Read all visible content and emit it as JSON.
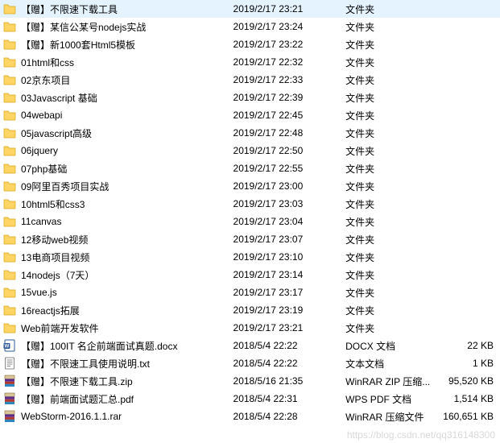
{
  "watermark": "https://blog.csdn.net/qq316148300",
  "items": [
    {
      "icon": "folder",
      "name": "【赠】不限速下载工具",
      "date": "2019/2/17 23:21",
      "type": "文件夹",
      "size": ""
    },
    {
      "icon": "folder",
      "name": "【赠】某信公某号nodejs实战",
      "date": "2019/2/17 23:24",
      "type": "文件夹",
      "size": ""
    },
    {
      "icon": "folder",
      "name": "【赠】新1000套Html5模板",
      "date": "2019/2/17 23:22",
      "type": "文件夹",
      "size": ""
    },
    {
      "icon": "folder",
      "name": "01html和css",
      "date": "2019/2/17 22:32",
      "type": "文件夹",
      "size": ""
    },
    {
      "icon": "folder",
      "name": "02京东项目",
      "date": "2019/2/17 22:33",
      "type": "文件夹",
      "size": ""
    },
    {
      "icon": "folder",
      "name": "03Javascript 基础",
      "date": "2019/2/17 22:39",
      "type": "文件夹",
      "size": ""
    },
    {
      "icon": "folder",
      "name": "04webapi",
      "date": "2019/2/17 22:45",
      "type": "文件夹",
      "size": ""
    },
    {
      "icon": "folder",
      "name": "05javascript高级",
      "date": "2019/2/17 22:48",
      "type": "文件夹",
      "size": ""
    },
    {
      "icon": "folder",
      "name": "06jquery",
      "date": "2019/2/17 22:50",
      "type": "文件夹",
      "size": ""
    },
    {
      "icon": "folder",
      "name": "07php基础",
      "date": "2019/2/17 22:55",
      "type": "文件夹",
      "size": ""
    },
    {
      "icon": "folder",
      "name": "09阿里百秀项目实战",
      "date": "2019/2/17 23:00",
      "type": "文件夹",
      "size": ""
    },
    {
      "icon": "folder",
      "name": "10html5和css3",
      "date": "2019/2/17 23:03",
      "type": "文件夹",
      "size": ""
    },
    {
      "icon": "folder",
      "name": "11canvas",
      "date": "2019/2/17 23:04",
      "type": "文件夹",
      "size": ""
    },
    {
      "icon": "folder",
      "name": "12移动web视频",
      "date": "2019/2/17 23:07",
      "type": "文件夹",
      "size": ""
    },
    {
      "icon": "folder",
      "name": "13电商项目视频",
      "date": "2019/2/17 23:10",
      "type": "文件夹",
      "size": ""
    },
    {
      "icon": "folder",
      "name": "14nodejs（7天）",
      "date": "2019/2/17 23:14",
      "type": "文件夹",
      "size": ""
    },
    {
      "icon": "folder",
      "name": "15vue.js",
      "date": "2019/2/17 23:17",
      "type": "文件夹",
      "size": ""
    },
    {
      "icon": "folder",
      "name": "16reactjs拓展",
      "date": "2019/2/17 23:19",
      "type": "文件夹",
      "size": ""
    },
    {
      "icon": "folder",
      "name": "Web前端开发软件",
      "date": "2019/2/17 23:21",
      "type": "文件夹",
      "size": ""
    },
    {
      "icon": "docx",
      "name": "【赠】100IT 名企前端面试真题.docx",
      "date": "2018/5/4 22:22",
      "type": "DOCX 文档",
      "size": "22 KB"
    },
    {
      "icon": "txt",
      "name": "【赠】不限速工具使用说明.txt",
      "date": "2018/5/4 22:22",
      "type": "文本文档",
      "size": "1 KB"
    },
    {
      "icon": "rar",
      "name": "【赠】不限速下载工具.zip",
      "date": "2018/5/16 21:35",
      "type": "WinRAR ZIP 压缩...",
      "size": "95,520 KB"
    },
    {
      "icon": "pdf",
      "name": "【赠】前端面试题汇总.pdf",
      "date": "2018/5/4 22:31",
      "type": "WPS PDF 文档",
      "size": "1,514 KB"
    },
    {
      "icon": "rar",
      "name": "WebStorm-2016.1.1.rar",
      "date": "2018/5/4 22:28",
      "type": "WinRAR 压缩文件",
      "size": "160,651 KB"
    }
  ]
}
